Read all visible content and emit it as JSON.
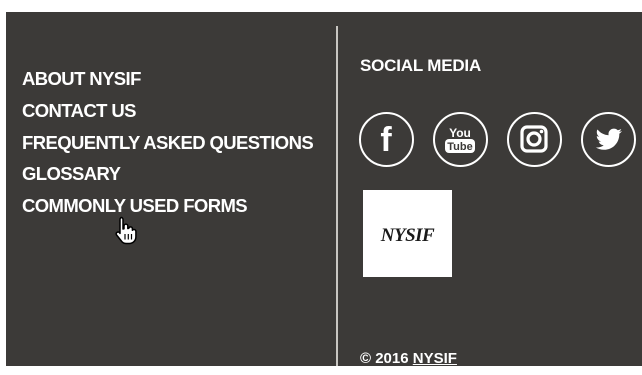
{
  "nav": {
    "links": [
      {
        "label": "ABOUT NYSIF"
      },
      {
        "label": "CONTACT US"
      },
      {
        "label": "FREQUENTLY ASKED QUESTIONS"
      },
      {
        "label": "GLOSSARY"
      },
      {
        "label": "COMMONLY USED FORMS"
      }
    ]
  },
  "social": {
    "title": "SOCIAL MEDIA",
    "icons": [
      {
        "name": "facebook-icon",
        "glyph": "f"
      },
      {
        "name": "youtube-icon",
        "line1": "You",
        "line2": "Tube"
      },
      {
        "name": "instagram-icon"
      },
      {
        "name": "twitter-icon"
      }
    ]
  },
  "logo": {
    "text": "NYSIF"
  },
  "footer": {
    "copyright_prefix": "© 2016 ",
    "copyright_link": "NYSIF"
  },
  "colors": {
    "background": "#3c3a38",
    "text": "#ffffff",
    "divider": "#c8c6c2"
  }
}
